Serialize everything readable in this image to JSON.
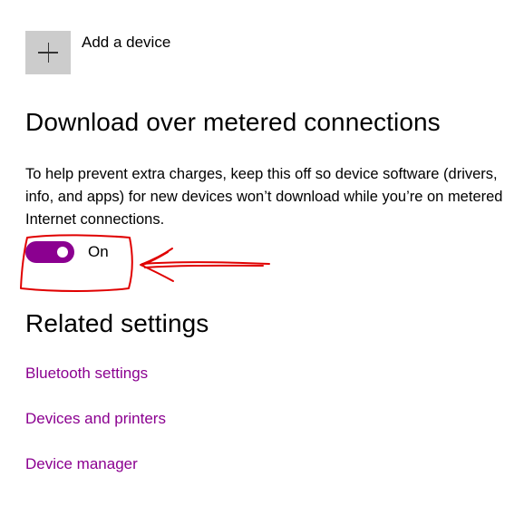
{
  "add_device": {
    "icon": "plus-icon",
    "label": "Add a device"
  },
  "metered": {
    "title": "Download over metered connections",
    "description": "To help prevent extra charges, keep this off so device software (drivers, info, and apps) for new devices won’t download while you’re on metered Internet connections.",
    "toggle": {
      "state": "On",
      "accent_color": "#8b0090"
    }
  },
  "related": {
    "title": "Related settings",
    "links": [
      {
        "label": "Bluetooth settings"
      },
      {
        "label": "Devices and printers"
      },
      {
        "label": "Device manager"
      }
    ],
    "link_color": "#8b0090"
  },
  "annotation": {
    "color": "#e00000",
    "shapes": [
      "hand-drawn-box",
      "hand-drawn-arrow"
    ]
  }
}
